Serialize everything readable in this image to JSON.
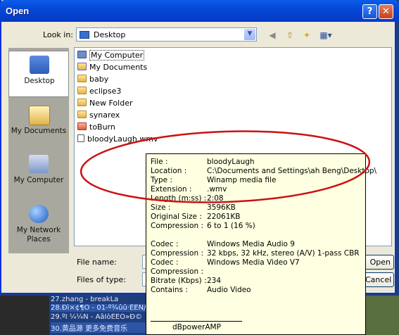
{
  "window": {
    "title": "Open",
    "help_glyph": "?",
    "close_glyph": "✕"
  },
  "toolbar": {
    "look_in_label": "Look in:",
    "look_in_value": "Desktop",
    "icons": [
      "back-icon",
      "up-folder-icon",
      "new-folder-icon",
      "views-menu-icon"
    ]
  },
  "places": [
    {
      "label": "Desktop",
      "icon": "desktop-icon",
      "selected": true
    },
    {
      "label": "My Documents",
      "icon": "my-documents-icon",
      "selected": false
    },
    {
      "label": "My Computer",
      "icon": "my-computer-icon",
      "selected": false
    },
    {
      "label": "My Network Places",
      "icon": "network-places-icon",
      "selected": false
    }
  ],
  "files": [
    {
      "name": "My Computer",
      "icon": "computer-icon"
    },
    {
      "name": "My Documents",
      "icon": "documents-folder-icon"
    },
    {
      "name": "baby",
      "icon": "folder-icon"
    },
    {
      "name": "eclipse3",
      "icon": "folder-icon"
    },
    {
      "name": "New Folder",
      "icon": "folder-icon"
    },
    {
      "name": "synarex",
      "icon": "folder-icon"
    },
    {
      "name": "toBurn",
      "icon": "burn-folder-icon"
    },
    {
      "name": "bloodyLaugh.wmv",
      "icon": "video-file-icon"
    }
  ],
  "bottom": {
    "file_name_label": "File name:",
    "file_name_value": "",
    "files_of_type_label": "Files of type:",
    "files_of_type_value": "",
    "open_button": "Open",
    "cancel_button": "Cancel"
  },
  "tooltip": {
    "rows1": [
      {
        "k": "File :",
        "v": "bloodyLaugh"
      },
      {
        "k": "Location :",
        "v": "C:\\Documents and Settings\\ah Beng\\Desktop\\"
      },
      {
        "k": "Type :",
        "v": "Winamp media file"
      },
      {
        "k": "Extension :",
        "v": ".wmv"
      },
      {
        "k": "Length (m:ss) :",
        "v": "2:08"
      },
      {
        "k": "Size :",
        "v": "3596KB"
      },
      {
        "k": "Original Size :",
        "v": "22061KB"
      },
      {
        "k": "Compression :",
        "v": "6 to 1  (16 %)"
      }
    ],
    "rows2": [
      {
        "k": "Codec :",
        "v": "Windows Media Audio 9"
      },
      {
        "k": "Compression :",
        "v": "32 kbps, 32 kHz, stereo (A/V) 1-pass CBR"
      },
      {
        "k": "Codec :",
        "v": "Windows Media Video V7"
      },
      {
        "k": "Compression :",
        "v": ""
      },
      {
        "k": "Bitrate (Kbps) :",
        "v": "234"
      },
      {
        "k": "Contains :",
        "v": "Audio    Video"
      }
    ],
    "footer": "dBpowerAMP"
  },
  "background_list": [
    "27.zhang - breakLa",
    "28.Ðì×¢¶Ö - 01-º¾ûû·ÊÈÑ/ÈÍ",
    "29.ºÏ ¼¼Ñ - ÄãÏòÊÈÒ»Ð©",
    "30.黄品源 更多免费音乐"
  ],
  "colors": {
    "titlebar": "#0548d8",
    "tooltip_bg": "#ffffe1",
    "highlight_ellipse": "#cc1111"
  }
}
